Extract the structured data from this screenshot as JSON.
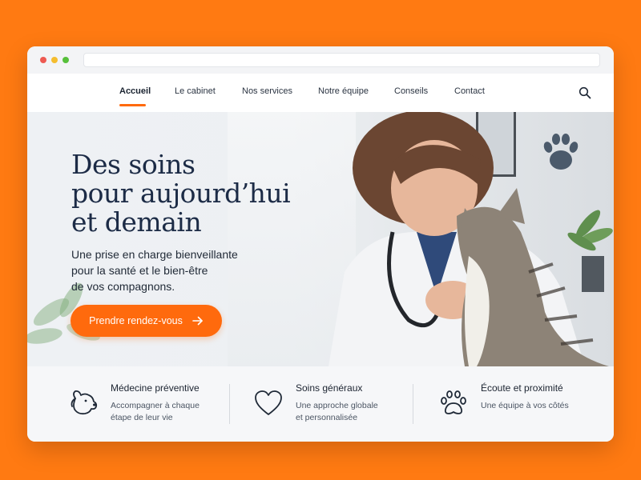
{
  "nav": {
    "items": [
      {
        "label": "Accueil",
        "active": true
      },
      {
        "label": "Le cabinet",
        "active": false
      },
      {
        "label": "Nos services",
        "active": false
      },
      {
        "label": "Notre équipe",
        "active": false
      },
      {
        "label": "Conseils",
        "active": false
      },
      {
        "label": "Contact",
        "active": false
      }
    ],
    "search_icon": "search-icon"
  },
  "hero": {
    "title_lines": [
      "Des soins",
      "pour aujourd’hui",
      "et demain"
    ],
    "text_lines": [
      "Une prise en charge bienveillante",
      "pour la santé et le bien-être",
      "de vos compagnons."
    ],
    "cta_label": "Prendre rendez-vous",
    "cta_icon": "arrow-right-icon"
  },
  "features": [
    {
      "icon": "dog-icon",
      "title": "Médecine préventive",
      "desc_lines": [
        "Accompagner à chaque",
        "étape de leur vie"
      ]
    },
    {
      "icon": "heart-icon",
      "title": "Soins généraux",
      "desc_lines": [
        "Une approche globale",
        "et personnalisée"
      ]
    },
    {
      "icon": "paw-icon",
      "title": "Écoute et proximité",
      "desc_lines": [
        "Une équipe à vos côtés"
      ]
    }
  ],
  "colors": {
    "accent": "#ff6a0d",
    "background": "#ff7a12",
    "title": "#1c2b46"
  }
}
